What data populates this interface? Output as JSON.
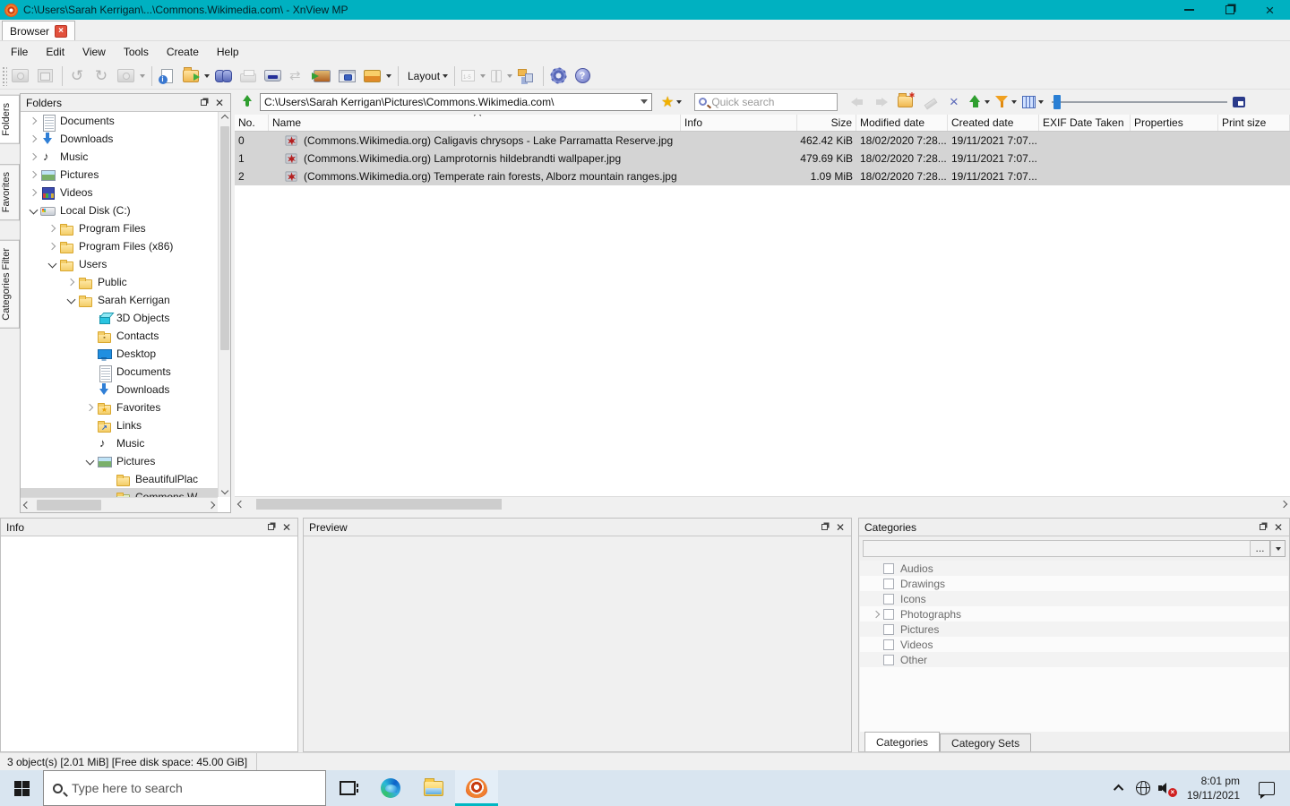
{
  "titlebar": {
    "title": "C:\\Users\\Sarah Kerrigan\\...\\Commons.Wikimedia.com\\ - XnView MP"
  },
  "tabbar": {
    "tab_label": "Browser"
  },
  "menu": {
    "items": [
      {
        "name": "menu-file",
        "label": "File"
      },
      {
        "name": "menu-edit",
        "label": "Edit"
      },
      {
        "name": "menu-view",
        "label": "View"
      },
      {
        "name": "menu-tools",
        "label": "Tools"
      },
      {
        "name": "menu-create",
        "label": "Create"
      },
      {
        "name": "menu-help",
        "label": "Help"
      }
    ]
  },
  "toolbar": {
    "buttons": [
      {
        "name": "view-image",
        "cls": "pic",
        "grayed": true
      },
      {
        "name": "fullscreen",
        "cls": "fs",
        "grayed": true
      },
      {
        "sep": true
      },
      {
        "name": "rotate-left",
        "glyph": "↺",
        "grayed": true
      },
      {
        "name": "rotate-right",
        "glyph": "↻",
        "grayed": true
      },
      {
        "name": "convert",
        "cls": "pic",
        "grayed": true,
        "caret": true
      },
      {
        "sep": true
      },
      {
        "name": "file-info",
        "cls": "info"
      },
      {
        "name": "open-folder",
        "cls": "openf",
        "caret": true
      },
      {
        "name": "search-binoculars",
        "cls": "binoc"
      },
      {
        "name": "print",
        "cls": "print",
        "grayed": true
      },
      {
        "name": "scan",
        "cls": "scan"
      },
      {
        "name": "compare",
        "cls": "compare",
        "grayed": true
      },
      {
        "name": "batch-convert",
        "cls": "batch"
      },
      {
        "name": "screen-capture",
        "cls": "capture"
      },
      {
        "name": "slideshow",
        "cls": "slideshow",
        "caret": true
      },
      {
        "sep": true
      },
      {
        "name": "layout",
        "label": "Layout",
        "caret": true
      },
      {
        "sep": true
      },
      {
        "name": "multipage",
        "cls": "multi",
        "grayed": true,
        "caret": true
      },
      {
        "name": "bookmark",
        "cls": "bookmark",
        "grayed": true,
        "caret": true
      },
      {
        "name": "tree-sync",
        "cls": "treeic"
      },
      {
        "sep": true
      },
      {
        "name": "settings-gear",
        "cls": "gear"
      },
      {
        "name": "help",
        "cls": "help"
      }
    ]
  },
  "address": {
    "path": "C:\\Users\\Sarah Kerrigan\\Pictures\\Commons.Wikimedia.com\\",
    "search_placeholder": "Quick search",
    "favorite_star": "★",
    "buttons": [
      {
        "name": "nav-back",
        "cls2": "arr-left",
        "grayed": true
      },
      {
        "name": "nav-forward",
        "cls2": "arr-right",
        "grayed": true
      },
      {
        "name": "new-folder",
        "cls": "newfolder"
      },
      {
        "name": "rename-edit",
        "cls": "edit",
        "grayed": true
      },
      {
        "name": "delete",
        "glyph": "×"
      },
      {
        "name": "move-up",
        "cls": "upgreen",
        "caret": true
      },
      {
        "name": "filter",
        "cls": "funnel",
        "caret": true
      },
      {
        "name": "view-mode",
        "cls": "grid",
        "caret": true
      }
    ]
  },
  "side_tabs": {
    "items": [
      {
        "name": "side-tab-folders",
        "label": "Folders",
        "active": true
      },
      {
        "name": "side-tab-favorites",
        "label": "Favorites"
      },
      {
        "name": "side-tab-categories-filter",
        "label": "Categories Filter"
      }
    ]
  },
  "folders_panel": {
    "title": "Folders",
    "tree": [
      {
        "label": "Documents",
        "depth": 1,
        "expander": "right",
        "icon": "doc"
      },
      {
        "label": "Downloads",
        "depth": 1,
        "expander": "right",
        "icon": "download"
      },
      {
        "label": "Music",
        "depth": 1,
        "expander": "right",
        "icon": "music"
      },
      {
        "label": "Pictures",
        "depth": 1,
        "expander": "right",
        "icon": "picture"
      },
      {
        "label": "Videos",
        "depth": 1,
        "expander": "right",
        "icon": "video"
      },
      {
        "label": "Local Disk (C:)",
        "depth": 1,
        "expander": "down",
        "icon": "disk"
      },
      {
        "label": "Program Files",
        "depth": 2,
        "expander": "right",
        "icon": "folder"
      },
      {
        "label": "Program Files (x86)",
        "depth": 2,
        "expander": "right",
        "icon": "folder"
      },
      {
        "label": "Users",
        "depth": 2,
        "expander": "down",
        "icon": "folder"
      },
      {
        "label": "Public",
        "depth": 3,
        "expander": "right",
        "icon": "folder"
      },
      {
        "label": "Sarah Kerrigan",
        "depth": 3,
        "expander": "down",
        "icon": "folder"
      },
      {
        "label": "3D Objects",
        "depth": 4,
        "icon": "cube"
      },
      {
        "label": "Contacts",
        "depth": 4,
        "icon": "contacts"
      },
      {
        "label": "Desktop",
        "depth": 4,
        "icon": "desktop"
      },
      {
        "label": "Documents",
        "depth": 4,
        "icon": "doc"
      },
      {
        "label": "Downloads",
        "depth": 4,
        "icon": "download"
      },
      {
        "label": "Favorites",
        "depth": 4,
        "expander": "right",
        "icon": "folder-fav"
      },
      {
        "label": "Links",
        "depth": 4,
        "icon": "folder-link"
      },
      {
        "label": "Music",
        "depth": 4,
        "icon": "music"
      },
      {
        "label": "Pictures",
        "depth": 4,
        "expander": "down",
        "icon": "picture"
      },
      {
        "label": "BeautifulPlac",
        "depth": 5,
        "icon": "folder"
      },
      {
        "label": "Commons.W",
        "depth": 5,
        "icon": "folder-green",
        "selected": true
      }
    ]
  },
  "file_list": {
    "columns": [
      {
        "label": "No.",
        "col": "num-col"
      },
      {
        "label": "Name",
        "sort": true
      },
      {
        "label": "Info"
      },
      {
        "label": "Size",
        "col": "size-col"
      },
      {
        "label": "Modified date"
      },
      {
        "label": "Created date"
      },
      {
        "label": "EXIF Date Taken"
      },
      {
        "label": "Properties"
      },
      {
        "label": "Print size"
      }
    ],
    "rows": [
      {
        "no": "0",
        "name": "(Commons.Wikimedia.org) Caligavis chrysops - Lake Parramatta Reserve.jpg",
        "info": "",
        "size": "462.42 KiB",
        "modified": "18/02/2020 7:28...",
        "created": "19/11/2021 7:07...",
        "exif": "",
        "properties": "",
        "printsize": ""
      },
      {
        "no": "1",
        "name": "(Commons.Wikimedia.org) Lamprotornis hildebrandti wallpaper.jpg",
        "info": "",
        "size": "479.69 KiB",
        "modified": "18/02/2020 7:28...",
        "created": "19/11/2021 7:07...",
        "exif": "",
        "properties": "",
        "printsize": ""
      },
      {
        "no": "2",
        "name": "(Commons.Wikimedia.org) Temperate rain forests, Alborz mountain ranges.jpg",
        "info": "",
        "size": "1.09 MiB",
        "modified": "18/02/2020 7:28...",
        "created": "19/11/2021 7:07...",
        "exif": "",
        "properties": "",
        "printsize": ""
      }
    ]
  },
  "info_panel": {
    "title": "Info"
  },
  "preview_panel": {
    "title": "Preview"
  },
  "categories_panel": {
    "title": "Categories",
    "browse_label": "...",
    "items": [
      {
        "label": "Audios"
      },
      {
        "label": "Drawings"
      },
      {
        "label": "Icons"
      },
      {
        "label": "Photographs",
        "expander": "right"
      },
      {
        "label": "Pictures"
      },
      {
        "label": "Videos"
      },
      {
        "label": "Other"
      }
    ],
    "tabs": [
      {
        "name": "tab-categories",
        "label": "Categories",
        "active": true
      },
      {
        "name": "tab-category-sets",
        "label": "Category Sets"
      }
    ]
  },
  "status_bar": {
    "text": "3 object(s) [2.01 MiB] [Free disk space: 45.00 GiB]"
  },
  "taskbar": {
    "search_placeholder": "Type here to search",
    "time": "8:01 pm",
    "date": "19/11/2021"
  },
  "colors": {
    "titlebar": "#00b1c1",
    "accent_underline": "#00b7c3",
    "selection": "#d4d4d4",
    "taskbar": "#d9e5f0"
  }
}
